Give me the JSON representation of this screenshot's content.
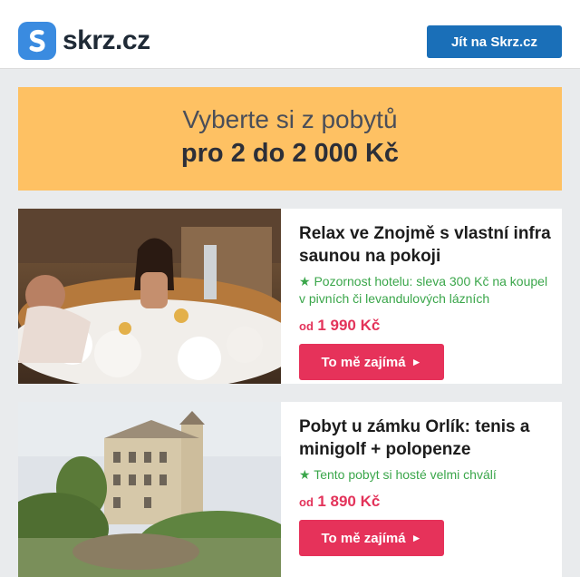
{
  "header": {
    "logo_text": "skrz.cz",
    "cta_label": "Jít na Skrz.cz"
  },
  "banner": {
    "line1": "Vyberte si z pobytů",
    "line2": "pro 2 do 2 000 Kč"
  },
  "offers": [
    {
      "title": "Relax ve Znojmě s vlastní infra saunou na pokoji",
      "note_icon": "★",
      "note": "Pozornost hotelu: sleva 300 Kč na koupel v pivních či levandulových lázních",
      "price_prefix": "od",
      "price": "1 990 Kč",
      "button_label": "To mě zajímá",
      "button_arrow": "►"
    },
    {
      "title": "Pobyt u zámku Orlík: tenis a minigolf + polopenze",
      "note_icon": "★",
      "note": "Tento pobyt si hosté velmi chválí",
      "price_prefix": "od",
      "price": "1 890 Kč",
      "button_label": "To mě zajímá",
      "button_arrow": "►"
    }
  ],
  "colors": {
    "brand_blue": "#3a8be0",
    "header_button": "#1a6fb8",
    "banner_bg": "#fec163",
    "accent_red": "#e6325a",
    "note_green": "#3aa64a"
  }
}
